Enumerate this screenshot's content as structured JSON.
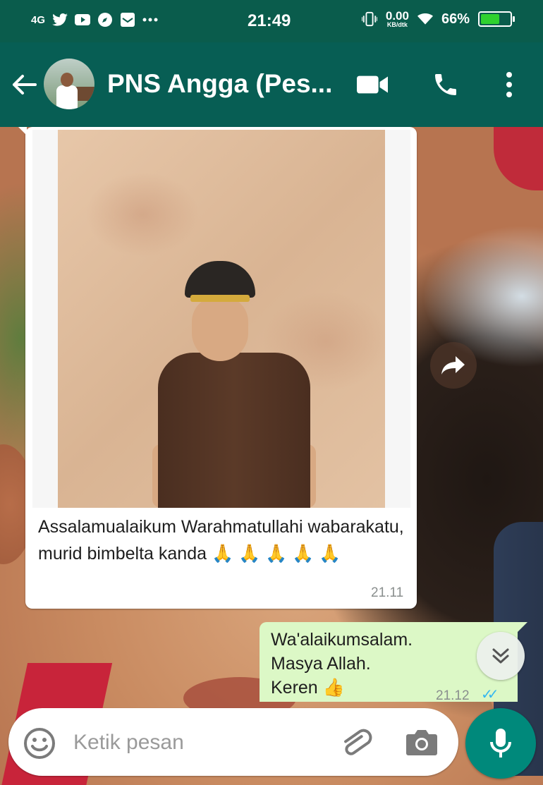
{
  "status_bar": {
    "network": "4G",
    "notification_icons": [
      "twitter-icon",
      "youtube-icon",
      "compass-icon",
      "mail-icon",
      "more-icon"
    ],
    "time": "21:49",
    "net_speed_value": "0.00",
    "net_speed_unit": "KB/dtk",
    "battery_percent": "66%",
    "battery_level": 0.66,
    "battery_color": "#2ed12e"
  },
  "header": {
    "contact_name": "PNS Angga (Pes...",
    "icons": [
      "back-arrow-icon",
      "video-call-icon",
      "phone-icon",
      "overflow-menu-icon"
    ],
    "background": "#075e54"
  },
  "messages": [
    {
      "direction": "incoming",
      "type": "image",
      "caption": "Assalamualaikum Warahmatullahi wabarakatu, murid bimbelta kanda 🙏 🙏 🙏 🙏 🙏",
      "time": "21.11"
    },
    {
      "direction": "outgoing",
      "text": "Wa'alaikumsalam.\nMasya Allah.\nKeren 👍",
      "time": "21.12",
      "status": "read",
      "status_color": "#34b7f1"
    }
  ],
  "composer": {
    "placeholder": "Ketik pesan",
    "icons": [
      "emoji-icon",
      "paperclip-icon",
      "camera-icon",
      "mic-icon"
    ],
    "accent": "#00897b"
  },
  "floating": {
    "icons": [
      "forward-icon",
      "scroll-down-icon"
    ]
  }
}
